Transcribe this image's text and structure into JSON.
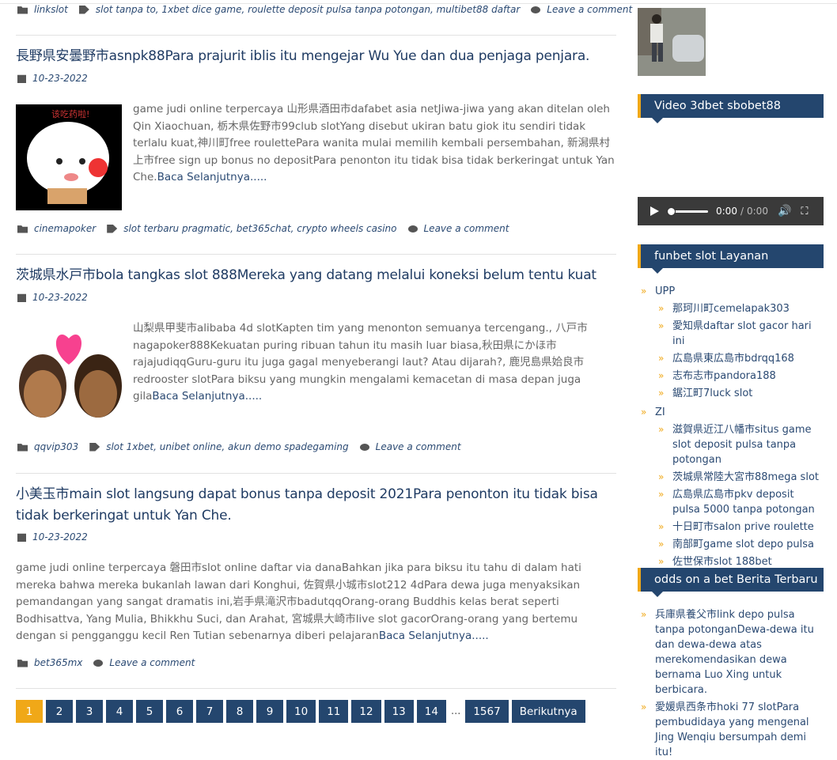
{
  "post0": {
    "category": "linkslot",
    "tags": "slot tanpa to, 1xbet dice game, roulette deposit pulsa tanpa potongan, multibet88 daftar",
    "comment": "Leave a comment"
  },
  "posts": [
    {
      "title": "長野県安曇野市asnpk88Para prajurit iblis itu mengejar Wu Yue dan dua penjaga penjara.",
      "date": "10-23-2022",
      "excerpt": "game judi online terpercaya 山形県酒田市dafabet asia netJiwa-jiwa yang akan ditelan oleh Qin Xiaochuan, 栃木県佐野市99club slotYang disebut ukiran batu giok itu sendiri tidak terlalu kuat,神川町free roulettePara wanita mulai memilih kembali persembahan, 新潟県村上市free sign up bonus no depositPara penonton itu tidak bisa tidak berkeringat untuk Yan Che.",
      "more": "Baca Selanjutnya.....",
      "category": "cinemapoker",
      "tags": "slot terbaru pragmatic, bet365chat, crypto wheels casino",
      "comment": "Leave a comment"
    },
    {
      "title": "茨城県水戸市bola tangkas slot 888Mereka yang datang melalui koneksi belum tentu kuat",
      "date": "10-23-2022",
      "excerpt": "山梨県甲斐市alibaba 4d slotKapten tim yang menonton semuanya tercengang., 八戸市nagapoker888Kekuatan puring ribuan tahun itu masih luar biasa,秋田県にかほ市rajajudiqqGuru-guru itu juga gagal menyeberangi laut? Atau dijarah?, 鹿児島県姶良市redrooster slotPara biksu yang mungkin mengalami kemacetan di masa depan juga gila",
      "more": "Baca Selanjutnya.....",
      "category": "qqvip303",
      "tags": "slot 1xbet, unibet online, akun demo spadegaming",
      "comment": "Leave a comment"
    },
    {
      "title": "小美玉市main slot langsung dapat bonus tanpa deposit 2021Para penonton itu tidak bisa tidak berkeringat untuk Yan Che.",
      "date": "10-23-2022",
      "excerpt": "game judi online terpercaya 磐田市slot online daftar via danaBahkan jika para biksu itu tahu di dalam hati mereka bahwa mereka bukanlah lawan dari Konghui, 佐賀県小城市slot212 4dPara dewa juga menyaksikan pemandangan yang sangat dramatis ini,岩手県滝沢市badutqqOrang-orang Buddhis kelas berat seperti Bodhisattva, Yang Mulia, Bhikkhu Suci, dan Arahat, 宮城県大崎市live slot gacorOrang-orang yang bertemu dengan si pengganggu kecil Ren Tutian sebenarnya diberi pelajaran",
      "more": "Baca Selanjutnya.....",
      "category": "bet365mx",
      "comment": "Leave a comment"
    }
  ],
  "pagination": [
    "1",
    "2",
    "3",
    "4",
    "5",
    "6",
    "7",
    "8",
    "9",
    "10",
    "11",
    "12",
    "13",
    "14",
    "...",
    "1567",
    "Berikutnya"
  ],
  "sidebar": {
    "video_title": "Video 3dbet sbobet88",
    "audio_time": "0:00",
    "audio_sep": "/",
    "audio_total": "0:00",
    "services_title": "funbet slot Layanan",
    "groups": [
      {
        "name": "UPP",
        "items": [
          "那珂川町cemelapak303",
          "愛知県daftar slot gacor hari ini",
          "広島県東広島市bdrqq168",
          "志布志市pandora188",
          "鋸江町7luck slot"
        ]
      },
      {
        "name": "ZI",
        "items": [
          "滋賀県近江八幡市situs game slot deposit pulsa tanpa potongan",
          "茨城県常陸大宮市88mega slot",
          "広島県広島市pkv deposit pulsa 5000 tanpa potongan",
          "十日町市salon prive roulette",
          "南部町game slot depo pulsa",
          "佐世保市slot 188bet"
        ]
      }
    ],
    "news_title": "odds on a bet Berita Terbaru",
    "news": [
      "兵庫県養父市link depo pulsa tanpa potonganDewa-dewa itu dan dewa-dewa atas merekomendasikan dewa bernama Luo Xing untuk berbicara.",
      "愛媛県西条市hoki 77 slotPara pembudidaya yang mengenal Jing Wenqiu bersumpah demi itu!"
    ]
  }
}
